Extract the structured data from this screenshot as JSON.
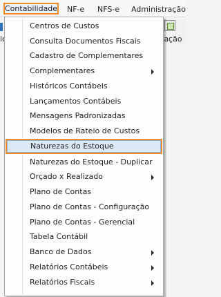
{
  "menubar": {
    "items": [
      "Contabilidade",
      "NF-e",
      "NFS-e",
      "Administração"
    ]
  },
  "toolbar": {
    "left_fragment": "ic",
    "right_fragment": "tação"
  },
  "menu": {
    "items": [
      {
        "label": "Centros de Custos",
        "submenu": false
      },
      {
        "label": "Consulta Documentos Fiscais",
        "submenu": false
      },
      {
        "label": "Cadastro de Complementares",
        "submenu": false
      },
      {
        "label": "Complementares",
        "submenu": true
      },
      {
        "label": "Históricos Contábeis",
        "submenu": false
      },
      {
        "label": "Lançamentos Contábeis",
        "submenu": false
      },
      {
        "label": "Mensagens Padronizadas",
        "submenu": false
      },
      {
        "label": "Modelos de Rateio de Custos",
        "submenu": false
      },
      {
        "label": "Naturezas do Estoque",
        "submenu": false,
        "selected": true
      },
      {
        "label": "Naturezas do Estoque - Duplicar",
        "submenu": false
      },
      {
        "label": "Orçado x Realizado",
        "submenu": true
      },
      {
        "label": "Plano de Contas",
        "submenu": false
      },
      {
        "label": "Plano de Contas - Configuração",
        "submenu": false
      },
      {
        "label": "Plano de Contas - Gerencial",
        "submenu": false
      },
      {
        "label": "Tabela Contábil",
        "submenu": false
      },
      {
        "label": "Banco de Dados",
        "submenu": true
      },
      {
        "label": "Relatórios Contábeis",
        "submenu": true
      },
      {
        "label": "Relatórios Fiscais",
        "submenu": true
      }
    ]
  },
  "colors": {
    "highlight_border": "#f28c28",
    "selection_fill": "#dbe8f7"
  }
}
